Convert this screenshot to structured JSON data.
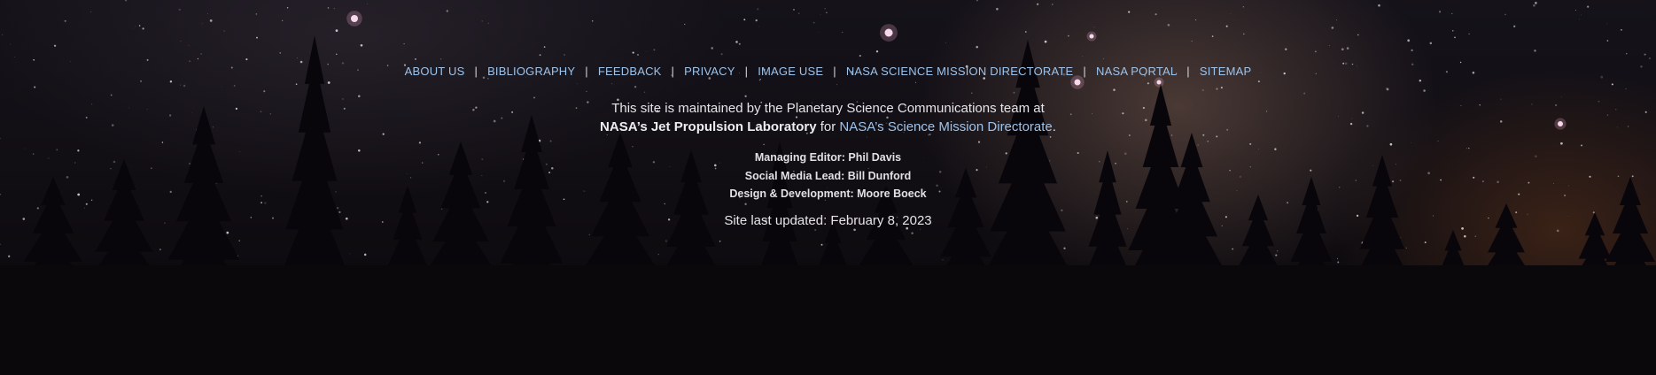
{
  "nav": {
    "items": [
      {
        "label": "ABOUT US"
      },
      {
        "label": "BIBLIOGRAPHY"
      },
      {
        "label": "FEEDBACK"
      },
      {
        "label": "PRIVACY"
      },
      {
        "label": "IMAGE USE"
      },
      {
        "label": "NASA SCIENCE MISSION DIRECTORATE"
      },
      {
        "label": "NASA PORTAL"
      },
      {
        "label": "SITEMAP"
      }
    ],
    "separator": "|"
  },
  "maintained": {
    "line1": "This site is maintained by the Planetary Science Communications team at",
    "org": "NASA’s Jet Propulsion Laboratory",
    "for_text": " for ",
    "smd_link": "NASA’s Science Mission Directorate",
    "period": "."
  },
  "credits": {
    "managing_editor": "Managing Editor: Phil Davis",
    "social_media": "Social Media Lead: Bill Dunford",
    "design": "Design & Development: Moore Boeck"
  },
  "updated": "Site last updated: February 8, 2023",
  "background": {
    "image": "night-sky-milky-way-with-tree-silhouettes",
    "colors": {
      "link": "#9ec3ea",
      "text": "#e6e4e8",
      "sky": "#100d12"
    }
  }
}
